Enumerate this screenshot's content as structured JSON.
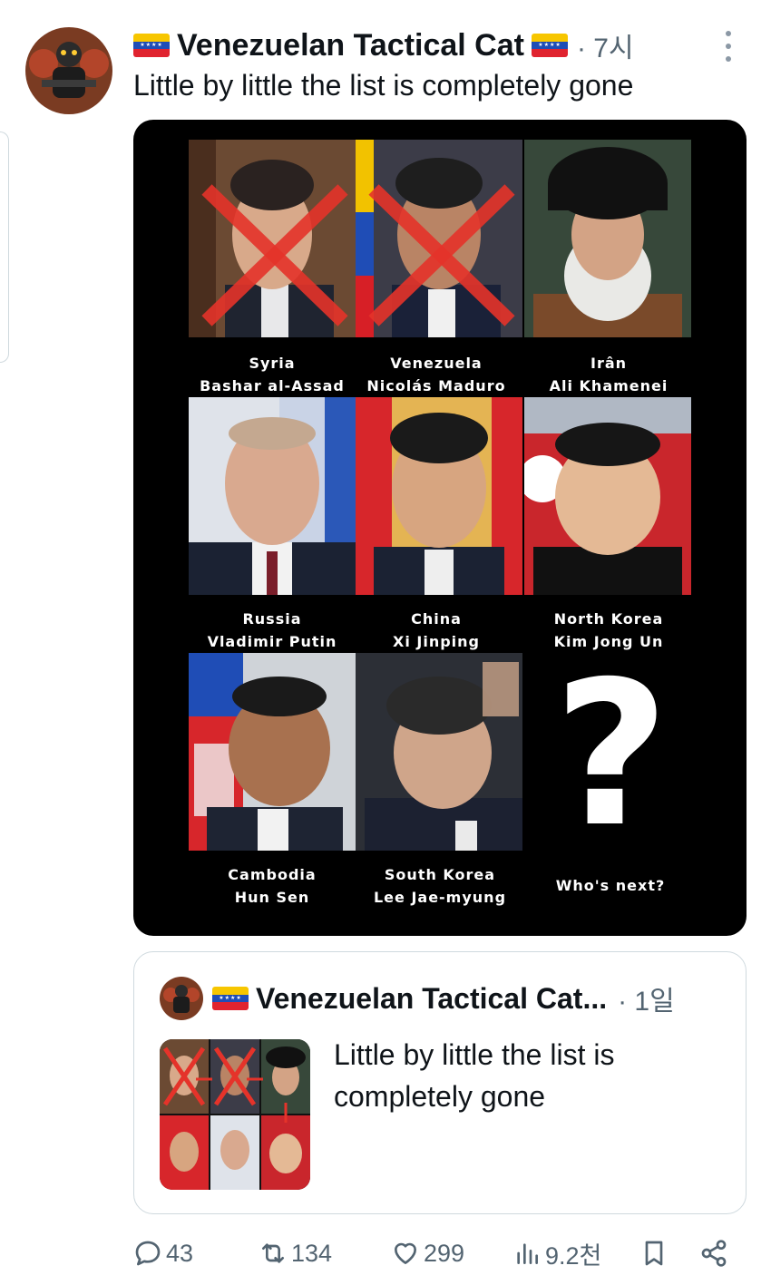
{
  "tweet": {
    "display_name": "Venezuelan Tactical Cat",
    "time": "· 7시",
    "text": "Little by little the list is completely gone"
  },
  "image_panels": [
    {
      "country": "Syria",
      "leader": "Bashar al-Assad",
      "crossed": true
    },
    {
      "country": "Venezuela",
      "leader": "Nicolás Maduro",
      "crossed": true
    },
    {
      "country": "Irân",
      "leader": "Ali Khamenei",
      "crossed": false
    },
    {
      "country": "Russia",
      "leader": "Vladimir Putin",
      "crossed": false
    },
    {
      "country": "China",
      "leader": "Xi Jinping",
      "crossed": false
    },
    {
      "country": "North Korea",
      "leader": "Kim Jong Un",
      "crossed": false
    },
    {
      "country": "Cambodia",
      "leader": "Hun Sen",
      "crossed": false
    },
    {
      "country": "South Korea",
      "leader": "Lee Jae-myung",
      "crossed": false
    }
  ],
  "question_panel": {
    "mark": "?",
    "caption": "Who's next?"
  },
  "quoted_tweet": {
    "display_name": "Venezuelan Tactical Cat...",
    "time": "· 1일",
    "text": "Little by little the list is completely gone"
  },
  "actions": {
    "replies": "43",
    "reposts": "134",
    "likes": "299",
    "views": "9.2천"
  },
  "colors": {
    "text_primary": "#0f1419",
    "text_secondary": "#536471",
    "border": "#cfd9de",
    "cross_red": "#e5332a"
  }
}
